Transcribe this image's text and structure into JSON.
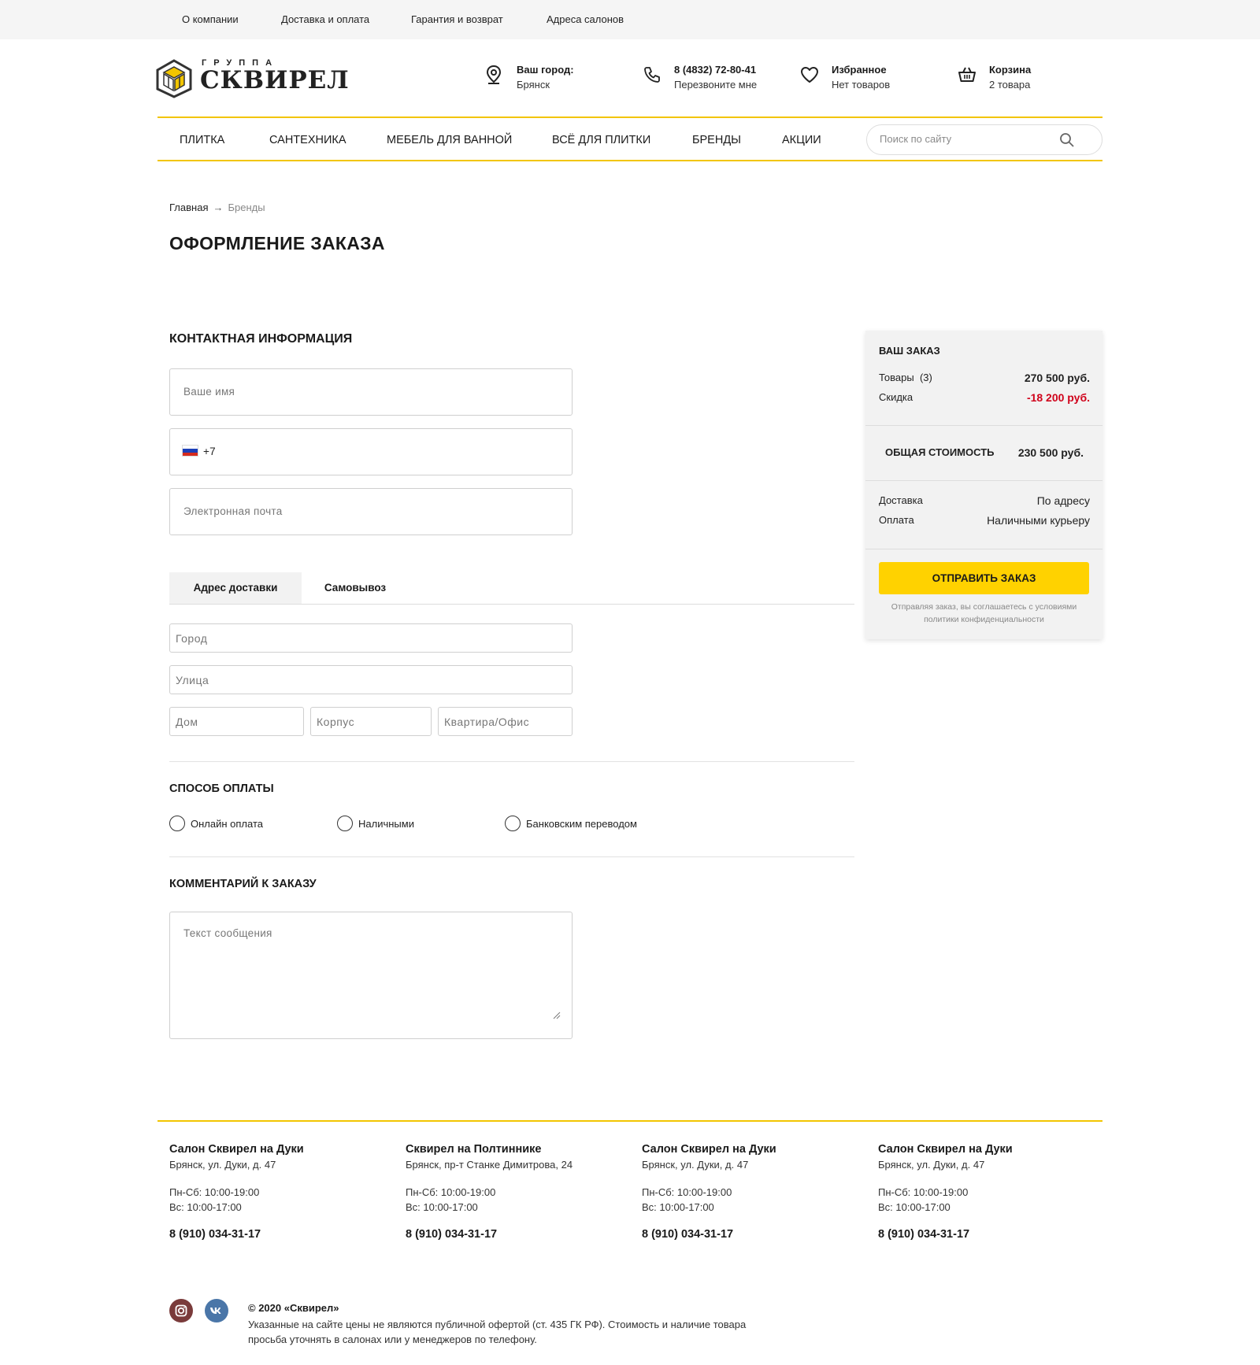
{
  "topbar": {
    "links": [
      "О компании",
      "Доставка и оплата",
      "Гарантия и возврат",
      "Адреса салонов"
    ]
  },
  "logo": {
    "sub": "ГРУППА",
    "main": "СКВИРЕЛ"
  },
  "header": {
    "city": {
      "label": "Ваш город:",
      "value": "Брянск"
    },
    "phone": {
      "number": "8 (4832) 72-80-41",
      "callback": "Перезвоните мне"
    },
    "favorites": {
      "label": "Избранное",
      "value": "Нет товаров"
    },
    "cart": {
      "label": "Корзина",
      "value": "2 товара"
    }
  },
  "nav": {
    "items": [
      "ПЛИТКА",
      "САНТЕХНИКА",
      "МЕБЕЛЬ ДЛЯ ВАННОЙ",
      "ВСЁ ДЛЯ ПЛИТКИ",
      "БРЕНДЫ",
      "АКЦИИ"
    ],
    "search_placeholder": "Поиск по сайту"
  },
  "breadcrumbs": {
    "home": "Главная",
    "arrow": "→",
    "current": "Бренды"
  },
  "page_title": "ОФОРМЛЕНИЕ ЗАКАЗА",
  "contact": {
    "heading": "КОНТАКТНАЯ ИНФОРМАЦИЯ",
    "name_placeholder": "Ваше имя",
    "phone_value": "+7",
    "email_placeholder": "Электронная почта"
  },
  "delivery": {
    "tabs": [
      "Адрес доставки",
      "Самовывоз"
    ],
    "city_placeholder": "Город",
    "street_placeholder": "Улица",
    "house_placeholder": "Дом",
    "building_placeholder": "Корпус",
    "apartment_placeholder": "Квартира/Офис"
  },
  "payment": {
    "heading": "СПОСОБ ОПЛАТЫ",
    "options": [
      "Онлайн оплата",
      "Наличными",
      "Банковским переводом"
    ]
  },
  "comment": {
    "heading": "КОММЕНТАРИЙ К ЗАКАЗУ",
    "placeholder": "Текст сообщения"
  },
  "order": {
    "title": "ВАШ ЗАКАЗ",
    "items_label": "Товары",
    "items_count": "(3)",
    "items_value": "270 500 руб.",
    "discount_label": "Скидка",
    "discount_value": "-18 200 руб.",
    "total_label": "ОБЩАЯ СТОИМОСТЬ",
    "total_value": "230 500 руб.",
    "delivery_label": "Доставка",
    "delivery_value": "По адресу",
    "payment_label": "Оплата",
    "payment_value": "Наличными курьеру",
    "submit": "ОТПРАВИТЬ ЗАКАЗ",
    "note": "Отправляя заказ, вы соглашаетесь с условиями политики конфиденциальности"
  },
  "salons": [
    {
      "name": "Салон Сквирел на Дуки",
      "address": "Брянск, ул. Дуки, д. 47",
      "hours_weekday": "Пн-Сб: 10:00-19:00",
      "hours_sunday": "Вс: 10:00-17:00",
      "phone": "8 (910) 034-31-17"
    },
    {
      "name": "Сквирел на Полтиннике",
      "address": "Брянск, пр-т Станке Димитрова, 24",
      "hours_weekday": "Пн-Сб: 10:00-19:00",
      "hours_sunday": "Вс: 10:00-17:00",
      "phone": "8 (910) 034-31-17"
    },
    {
      "name": "Салон Сквирел на Дуки",
      "address": "Брянск, ул. Дуки, д. 47",
      "hours_weekday": "Пн-Сб: 10:00-19:00",
      "hours_sunday": "Вс: 10:00-17:00",
      "phone": "8 (910) 034-31-17"
    },
    {
      "name": "Салон Сквирел на Дуки",
      "address": "Брянск, ул. Дуки, д. 47",
      "hours_weekday": "Пн-Сб: 10:00-19:00",
      "hours_sunday": "Вс: 10:00-17:00",
      "phone": "8 (910) 034-31-17"
    }
  ],
  "footer": {
    "copyright": "© 2020 «Сквирел»",
    "legal": "Указанные на сайте цены не являются публичной офертой (ст. 435 ГК РФ). Стоимость и наличие товара просьба уточнять в салонах или у менеджеров по телефону.",
    "social": [
      "instagram-icon",
      "vk-icon"
    ]
  },
  "colors": {
    "accent_yellow": "#ffd200",
    "divider_yellow": "#f2c500",
    "discount_red": "#d0021b",
    "instagram": "#7a3b3b",
    "vk": "#4a76a8"
  }
}
